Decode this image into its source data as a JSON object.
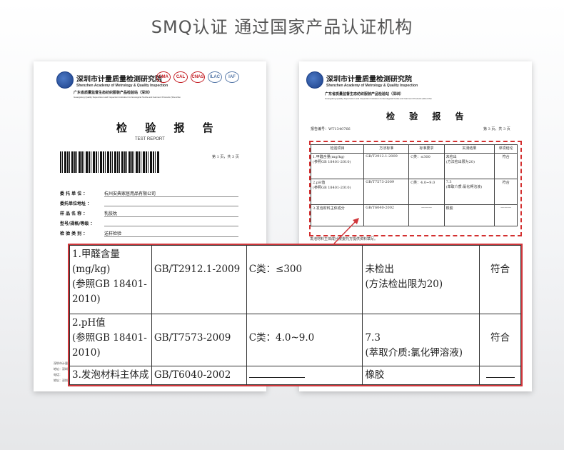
{
  "headline": "SMQ认证 通过国家产品认证机构",
  "institute": {
    "name_cn": "深圳市计量质量检测研究院",
    "name_en": "Shenzhen Academy of Metrology & Quality Inspection",
    "center_cn": "广东省质量监督生态纺织服装产品检验站（深圳）",
    "center_en": "Guangdong Quality Supervision and Inspection Institution for Ecological Textile and Garment Products (Shenzhen)"
  },
  "cert_logos": [
    "CMA",
    "CAL",
    "CNAS",
    "ILAC",
    "IAF"
  ],
  "left_sheet": {
    "title": "检 验 报 告",
    "title_en": "TEST REPORT",
    "page_no": "第 1 页，共 3 页",
    "fields": [
      {
        "label": "委 托 单 位 ：",
        "value": "杭州安典家居用品有限公司"
      },
      {
        "label": "委托单位地址 ：",
        "value": ""
      },
      {
        "label": "样 品 名 称 ：",
        "value": "乳胶枕"
      },
      {
        "label": "型号/规格/等级 ：",
        "value": ""
      },
      {
        "label": "检 验 类 别 ：",
        "value": "送样检验"
      }
    ],
    "footer": [
      "深圳市计量质量检测研究院",
      "地址：深圳市南山区",
      "电话：",
      "地址：深圳市福田区"
    ]
  },
  "right_sheet": {
    "title": "检 验 报 告",
    "report_no": "报告编号：WT1340766",
    "page_no": "第 3 页，共 3 页",
    "headers": [
      "检验项目",
      "方法标准",
      "标准要求",
      "实测结果",
      "单项结论"
    ],
    "rows": [
      [
        "1.甲醛含量(mg/kg)\n(参照GB 18401-2010)",
        "GB/T2912.1-2009",
        "C类：≤300",
        "未检出\n(方法检出限为20)",
        "符合"
      ],
      [
        "2.pH值\n(参照GB 18401-2010)",
        "GB/T7573-2009",
        "C类：4.0~9.0",
        "7.3\n(萃取介质:氯化钾溶液)",
        "符合"
      ],
      [
        "3.发泡材料主体成分",
        "GB/T6040-2002",
        "———",
        "橡胶",
        "———"
      ]
    ],
    "note": "发泡材料主体成分按委托方提供资料填写。"
  },
  "zoom_table": {
    "row1": {
      "item_line1": "1.甲醛含量(mg/kg)",
      "item_line2": "(参照GB 18401-",
      "item_line3": "2010)",
      "method": "GB/T2912.1-2009",
      "requirement": "C类：≤300",
      "result_line1": "未检出",
      "result_line2": "(方法检出限为20)",
      "conclusion": "符合"
    },
    "row2": {
      "item_line1": "2.pH值",
      "item_line2": "(参照GB 18401-",
      "item_line3": "2010)",
      "method": "GB/T7573-2009",
      "requirement": "C类：4.0~9.0",
      "result_line1": "7.3",
      "result_line2": "(萃取介质:氯化钾溶液)",
      "conclusion": "符合"
    },
    "row3": {
      "item": "3.发泡材料主体成",
      "method": "GB/T6040-2002",
      "result": "橡胶"
    }
  },
  "colors": {
    "highlight_red": "#d0363b",
    "institute_blue": "#1b3f87"
  }
}
